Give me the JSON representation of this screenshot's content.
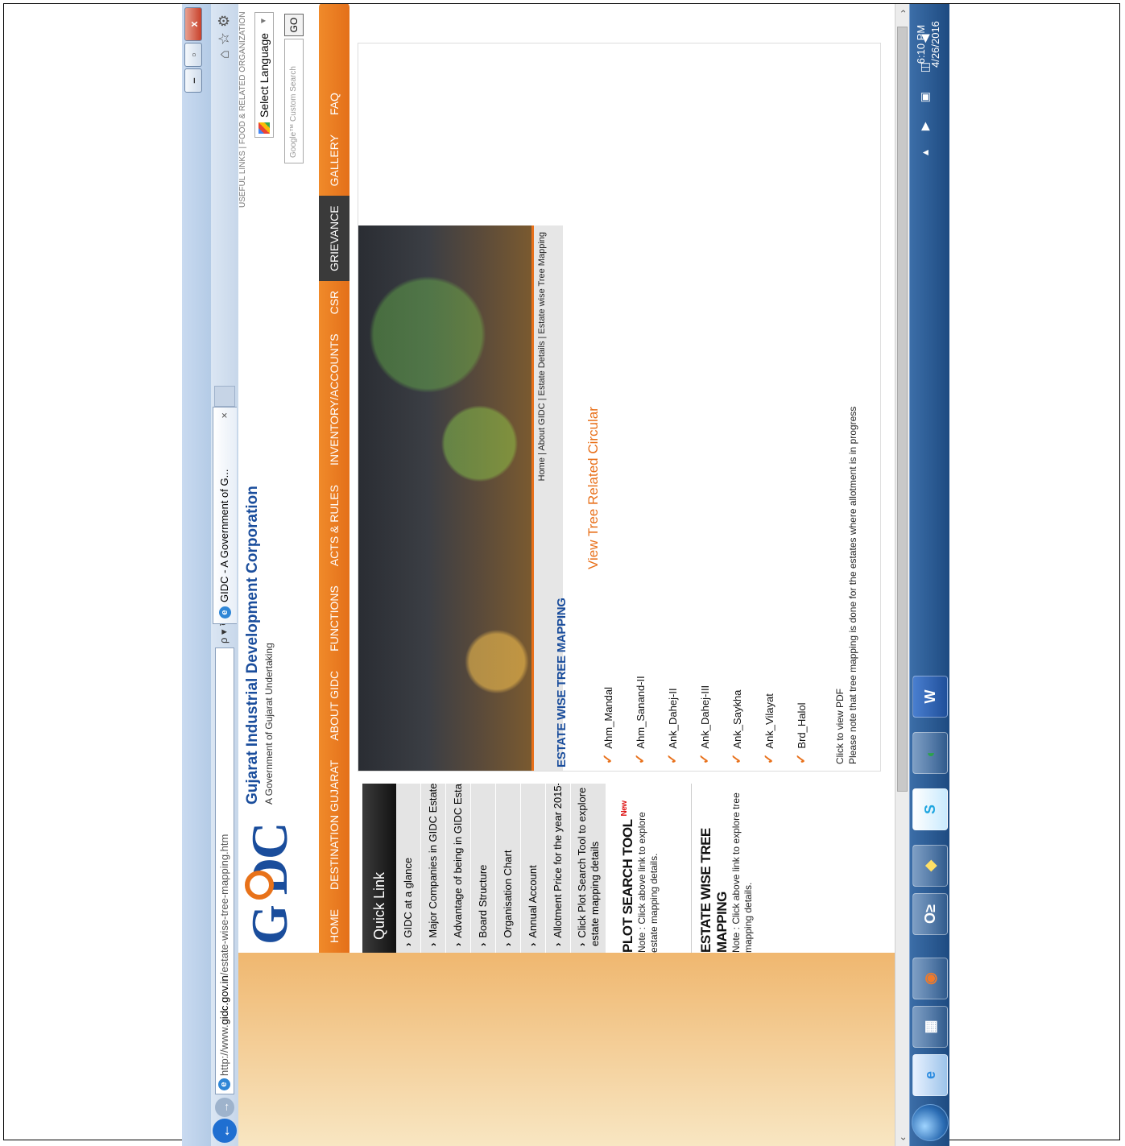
{
  "browser": {
    "url_prefix": "http://www.",
    "url_host": "gidc.gov.in",
    "url_path": "/estate-wise-tree-mapping.htm",
    "url_tools": "ρ ▾ ↻",
    "tab_title": "GIDC - A Government of G...",
    "tab_close": "×",
    "caption_min": "–",
    "caption_max": "▫",
    "caption_close": "x",
    "back_glyph": "←",
    "forward_glyph": "→",
    "cmd_icons": "⌂☆⚙"
  },
  "header": {
    "logo_text": "G  DC",
    "site_name": "Gujarat Industrial Development Corporation",
    "tagline": "A Government of Gujarat Undertaking",
    "top_links": "USEFUL LINKS | FOOD & RELATED ORGANIZATION",
    "language_select": "Select Language",
    "language_arrow": "▼",
    "search_placeholder": "Google™ Custom Search",
    "go_label": "GO"
  },
  "nav": {
    "items": [
      "HOME",
      "DESTINATION GUJARAT",
      "ABOUT GIDC",
      "FUNCTIONS",
      "ACTS & RULES",
      "INVENTORY/ACCOUNTS",
      "CSR",
      "GRIEVANCE",
      "GALLERY",
      "FAQ"
    ]
  },
  "sidebar": {
    "heading": "Quick Link",
    "items": [
      "GIDC at a glance",
      "Major Companies in GIDC Estate",
      "Advantage of being in GIDC Estate",
      "Board Structure",
      "Organisation Chart",
      "Annual Account",
      "Allotment Price for the year 2015-16",
      "Click Plot Search Tool to explore estate mapping details"
    ],
    "chevron": "›",
    "plot_tool_title": "PLOT SEARCH TOOL",
    "plot_tool_badge": "New",
    "plot_tool_note": "Note : Click above link to explore estate mapping details.",
    "tree_tool_title": "ESTATE WISE TREE MAPPING",
    "tree_tool_note": "Note : Click above link to explore tree mapping details."
  },
  "main": {
    "breadcrumb": "Home | About GIDC | Estate Details | Estate wise Tree Mapping",
    "section_title": "ESTATE WISE TREE MAPPING",
    "circular_link": "View Tree Related Circular",
    "tick": "✓",
    "estates": [
      "Ahm_Mandal",
      "Ahm_Sanand-II",
      "Ank_Dahej-II",
      "Ank_Dahej-III",
      "Ank_Saykha",
      "Ank_Vilayat",
      "Brd_Halol"
    ],
    "pdf_hint": "Click to view PDF",
    "note": "Please note that tree mapping is done for the estates where allotment is in progress"
  },
  "scrollbar": {
    "left_arrow": "‹",
    "right_arrow": "›"
  },
  "taskbar": {
    "apps": [
      "e",
      "▦",
      "◉",
      "O≥",
      "◆",
      "S",
      "◐",
      "W"
    ],
    "tray": "▴ ▶ ▣ ◫ ◀",
    "time": "6:10 PM",
    "date": "4/26/2016"
  }
}
